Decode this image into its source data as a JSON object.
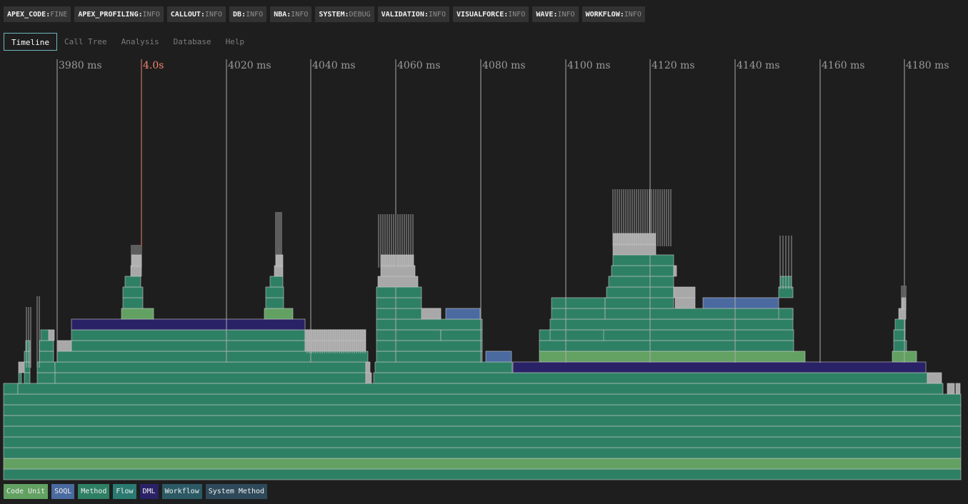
{
  "log_levels": [
    {
      "category": "APEX_CODE",
      "level": "FINE"
    },
    {
      "category": "APEX_PROFILING",
      "level": "INFO"
    },
    {
      "category": "CALLOUT",
      "level": "INFO"
    },
    {
      "category": "DB",
      "level": "INFO"
    },
    {
      "category": "NBA",
      "level": "INFO"
    },
    {
      "category": "SYSTEM",
      "level": "DEBUG"
    },
    {
      "category": "VALIDATION",
      "level": "INFO"
    },
    {
      "category": "VISUALFORCE",
      "level": "INFO"
    },
    {
      "category": "WAVE",
      "level": "INFO"
    },
    {
      "category": "WORKFLOW",
      "level": "INFO"
    }
  ],
  "tabs": [
    {
      "label": "Timeline",
      "active": true
    },
    {
      "label": "Call Tree",
      "active": false
    },
    {
      "label": "Analysis",
      "active": false
    },
    {
      "label": "Database",
      "active": false
    },
    {
      "label": "Help",
      "active": false
    }
  ],
  "timeline": {
    "time_labels": [
      "3980 ms",
      "4.0s",
      "4020 ms",
      "4040 ms",
      "4060 ms",
      "4080 ms",
      "4100 ms",
      "4120 ms",
      "4140 ms",
      "4160 ms",
      "4180 ms"
    ],
    "highlight_label": "4.0s",
    "highlight_color": "#f0866b",
    "gridline_color": "#aaaaaa"
  },
  "legend": [
    {
      "label": "Code Unit",
      "color": "#62a162"
    },
    {
      "label": "SOQL",
      "color": "#4a6aa0"
    },
    {
      "label": "Method",
      "color": "#2e8065"
    },
    {
      "label": "Flow",
      "color": "#2a7a72"
    },
    {
      "label": "DML",
      "color": "#2a2266"
    },
    {
      "label": "Workflow",
      "color": "#2b5a64"
    },
    {
      "label": "System Method",
      "color": "#2e4a5a"
    }
  ]
}
